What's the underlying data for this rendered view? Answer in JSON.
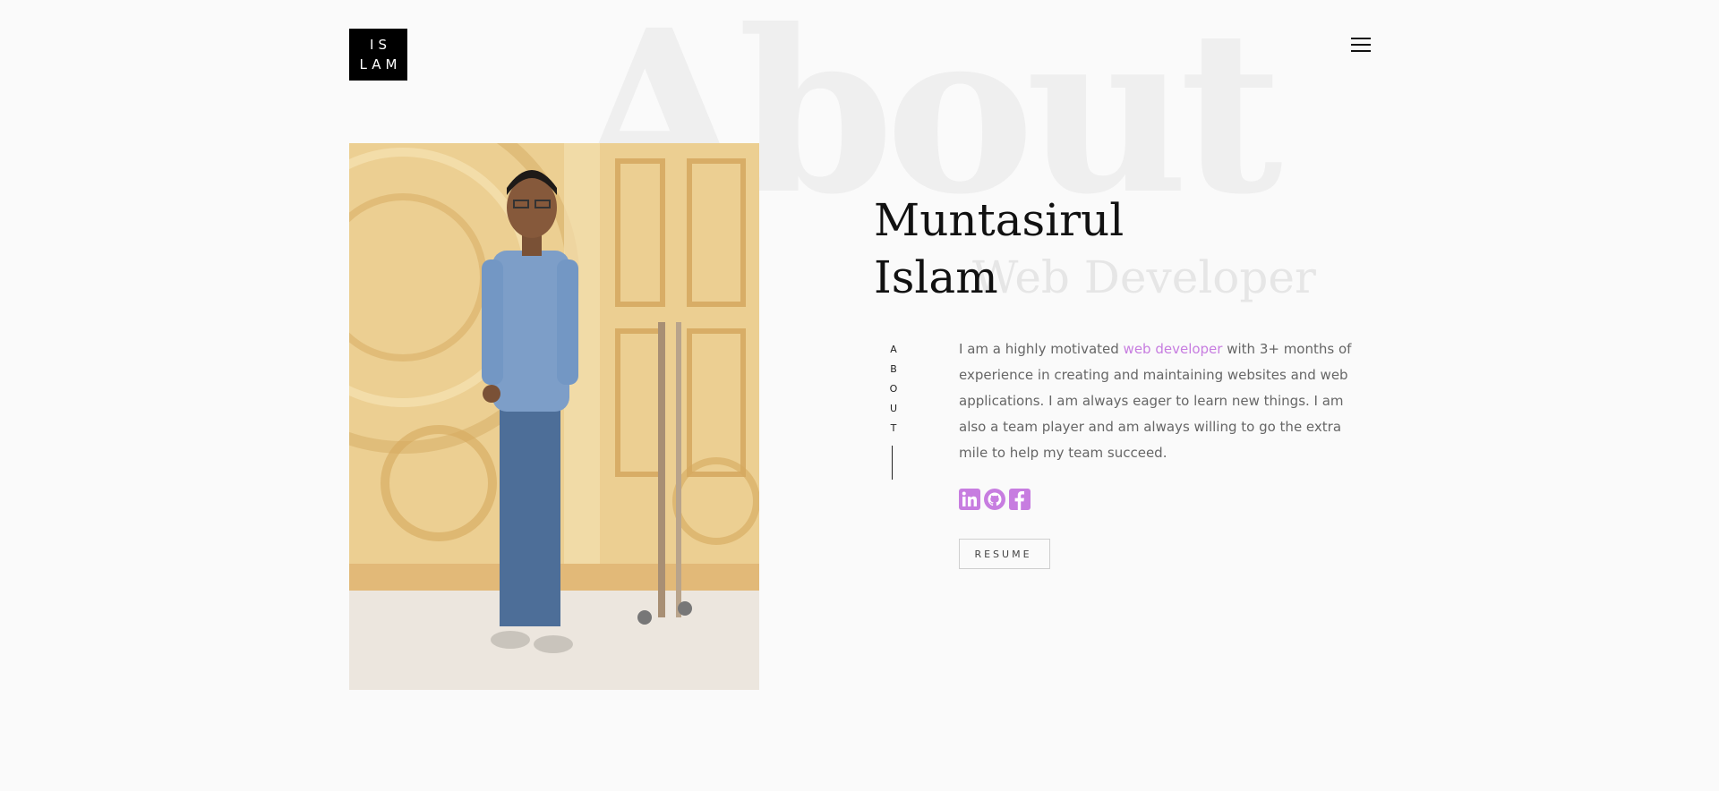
{
  "logo": {
    "line1": "IS",
    "line2": "LAM"
  },
  "hero": {
    "background_word": "About",
    "name_first": "Muntasirul",
    "name_last": "Islam",
    "role": "Web Developer"
  },
  "side_label": [
    "A",
    "B",
    "O",
    "U",
    "T"
  ],
  "bio": {
    "before": "I am a highly motivated ",
    "highlight": "web developer",
    "after": " with 3+ months of experience in creating and maintaining websites and web applications. I am always eager to learn new things. I am also a team player and am always willing to go the extra mile to help my team succeed."
  },
  "social": [
    {
      "icon": "linkedin-icon"
    },
    {
      "icon": "github-icon"
    },
    {
      "icon": "facebook-icon"
    }
  ],
  "resume_button": "RESUME",
  "colors": {
    "accent": "#c77de0",
    "background": "#fafafa",
    "logo_bg": "#000000"
  }
}
